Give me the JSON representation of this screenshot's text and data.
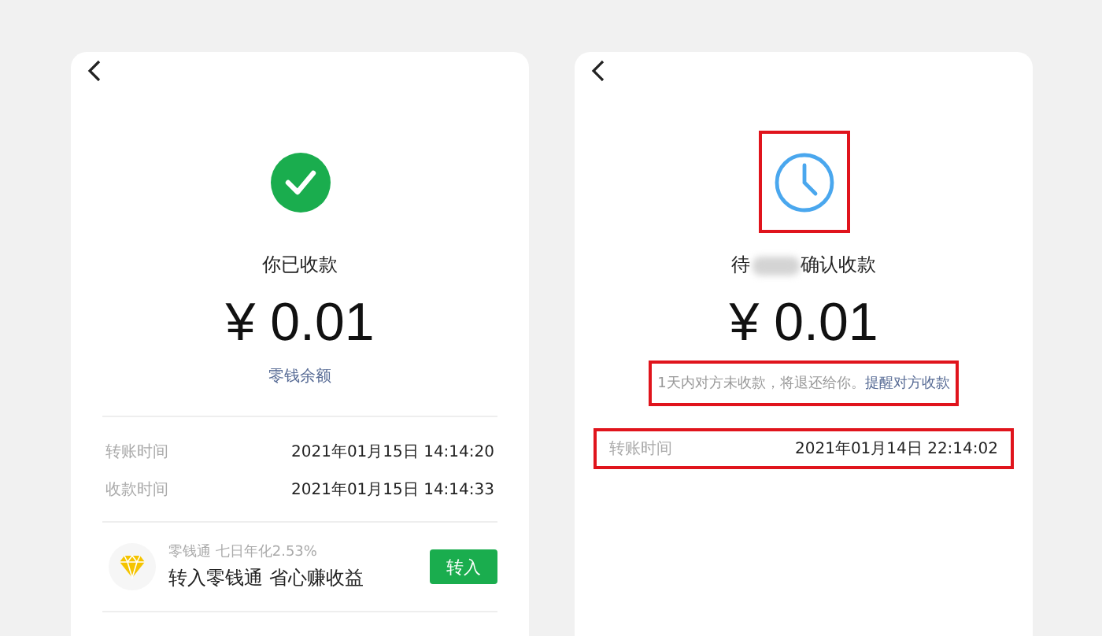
{
  "screens": [
    {
      "kind": "received",
      "highlighted_icon": false,
      "title": "你已收款",
      "amount": "¥ 0.01",
      "link": "零钱余额",
      "rows": [
        {
          "label": "转账时间",
          "value": "2021年01月15日 14:14:20",
          "highlighted": false
        },
        {
          "label": "收款时间",
          "value": "2021年01月15日 14:14:33",
          "highlighted": false
        }
      ],
      "promo": {
        "subtitle": "零钱通 七日年化2.53%",
        "text": "转入零钱通 省心赚收益",
        "button": "转入"
      }
    },
    {
      "kind": "pending",
      "highlighted_icon": true,
      "title": "待",
      "title_end": "确认收款",
      "amount": "¥ 0.01",
      "notice": {
        "text": "1天内对方未收款，将退还给你。",
        "link": "提醒对方收款",
        "highlighted": true
      },
      "rows": [
        {
          "label": "转账时间",
          "value": "2021年01月14日 22:14:02",
          "highlighted": true
        }
      ]
    }
  ]
}
